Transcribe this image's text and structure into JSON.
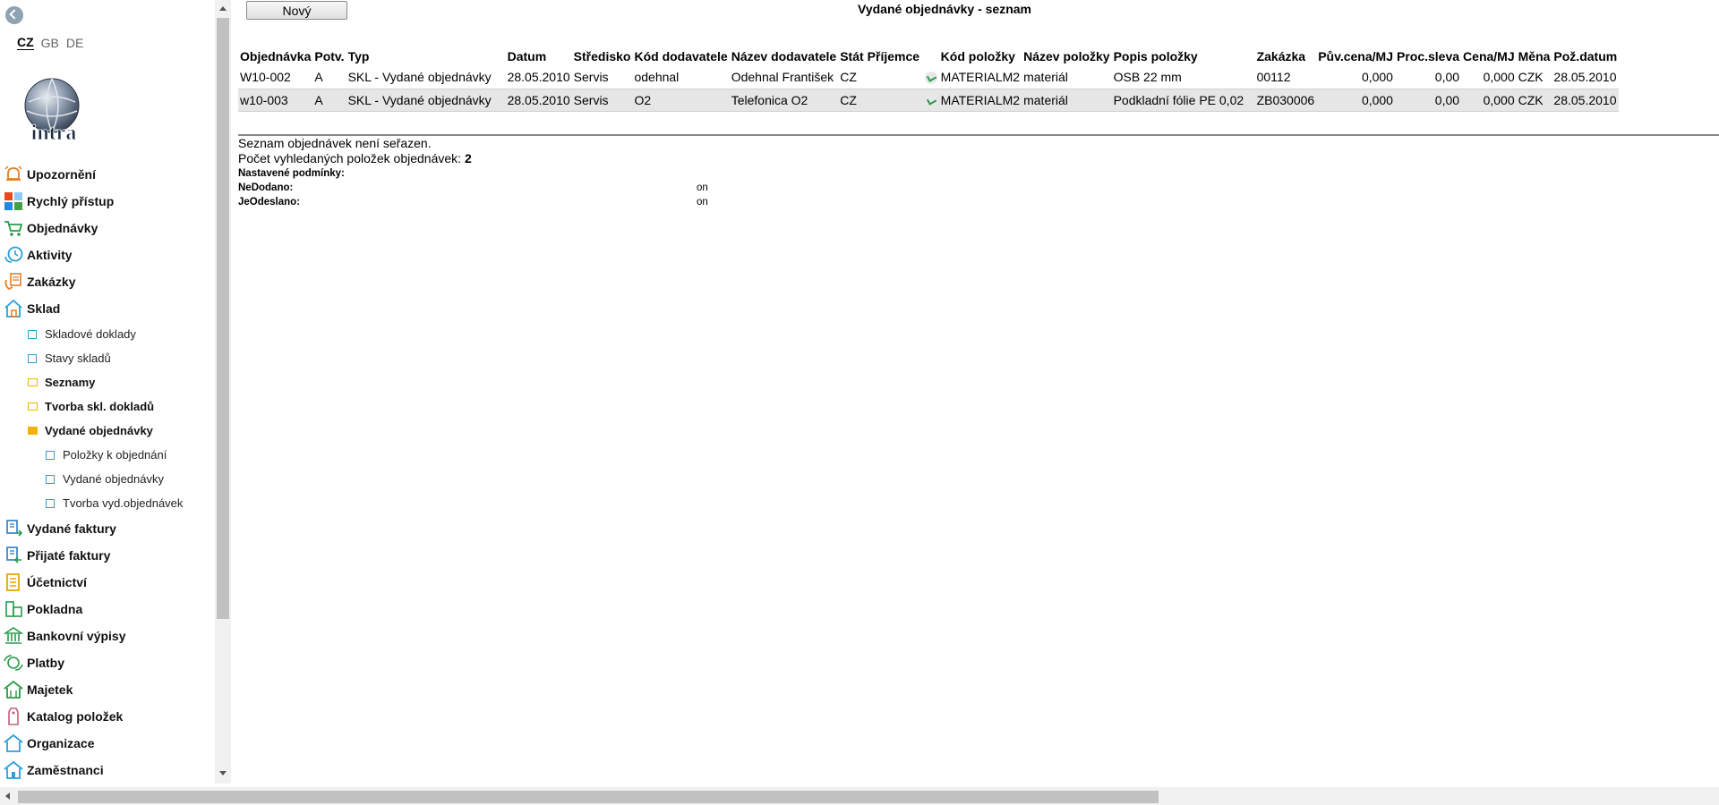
{
  "sidebar": {
    "languages": [
      "CZ",
      "GB",
      "DE"
    ],
    "logo_text": "intra",
    "nav": [
      {
        "label": "Upozornění",
        "icon": "alarm-icon",
        "color": "#e67e22"
      },
      {
        "label": "Rychlý přístup",
        "icon": "quick-access-icon",
        "color": "#2e7bbf"
      },
      {
        "label": "Objednávky",
        "icon": "cart-icon",
        "color": "#2a9a4a"
      },
      {
        "label": "Aktivity",
        "icon": "activity-clock-icon",
        "color": "#2aa0d8"
      },
      {
        "label": "Zakázky",
        "icon": "contracts-icon",
        "color": "#e67e22"
      },
      {
        "label": "Sklad",
        "icon": "warehouse-icon",
        "color": "#2aa0d8"
      }
    ],
    "sklad_sub": [
      {
        "label": "Skladové doklady",
        "type": "page"
      },
      {
        "label": "Stavy skladů",
        "type": "page"
      },
      {
        "label": "Seznamy",
        "type": "folder"
      },
      {
        "label": "Tvorba skl. dokladů",
        "type": "folder"
      },
      {
        "label": "Vydané objednávky",
        "type": "folder-open"
      }
    ],
    "vydane_sub": [
      {
        "label": "Položky k objednání"
      },
      {
        "label": "Vydané objednávky"
      },
      {
        "label": "Tvorba vyd.objednávek"
      }
    ],
    "nav2": [
      {
        "label": "Vydané faktury",
        "icon": "issued-invoice-icon",
        "color": "#2e7bbf"
      },
      {
        "label": "Přijaté faktury",
        "icon": "received-invoice-icon",
        "color": "#2e7bbf"
      },
      {
        "label": "Účetnictví",
        "icon": "accounting-icon",
        "color": "#e6a700"
      },
      {
        "label": "Pokladna",
        "icon": "cashdesk-icon",
        "color": "#2a9a4a"
      },
      {
        "label": "Bankovní výpisy",
        "icon": "bank-icon",
        "color": "#2a9a4a"
      },
      {
        "label": "Platby",
        "icon": "payments-icon",
        "color": "#2a9a4a"
      },
      {
        "label": "Majetek",
        "icon": "property-icon",
        "color": "#2a9a4a"
      },
      {
        "label": "Katalog položek",
        "icon": "catalog-tag-icon",
        "color": "#c0607a"
      },
      {
        "label": "Organizace",
        "icon": "organization-icon",
        "color": "#2aa0d8"
      },
      {
        "label": "Zaměstnanci",
        "icon": "employees-icon",
        "color": "#2aa0d8"
      }
    ]
  },
  "toolbar": {
    "new_label": "Nový"
  },
  "page_title": "Vydané objednávky - seznam",
  "table": {
    "columns": [
      "Objednávka",
      "Potv.",
      "Typ",
      "Datum",
      "Středisko",
      "Kód dodavatele",
      "Název dodavatele",
      "Stát",
      "Příjemce",
      "Kód položky",
      "Název položky",
      "Popis položky",
      "Zakázka",
      "Pův.cena/MJ",
      "Proc.sleva",
      "Cena/MJ",
      "Měna",
      "Pož.datum"
    ],
    "rows": [
      [
        "W10-002",
        "A",
        "SKL - Vydané objednávky",
        "28.05.2010",
        "Servis",
        "odehnal",
        "Odehnal František",
        "CZ",
        "",
        "MATERIALM2",
        "materiál",
        "OSB 22 mm",
        "00112",
        "0,000",
        "0,00",
        "0,000",
        "CZK",
        "28.05.2010"
      ],
      [
        "w10-003",
        "A",
        "SKL - Vydané objednávky",
        "28.05.2010",
        "Servis",
        "O2",
        "Telefonica O2",
        "CZ",
        "",
        "MATERIALM2",
        "materiál",
        "Podkladní fólie PE 0,02",
        "ZB030006",
        "0,000",
        "0,00",
        "0,000",
        "CZK",
        "28.05.2010"
      ]
    ]
  },
  "info": {
    "sort_status": "Seznam objednávek není seřazen.",
    "count_label": "Počet vyhledaných položek objednávek:",
    "count_value": "2"
  },
  "conditions": {
    "heading": "Nastavené podmínky:",
    "items": [
      {
        "name": "NeDodano:",
        "value": "on"
      },
      {
        "name": "JeOdeslano:",
        "value": "on"
      }
    ]
  },
  "colors": {
    "accent": "#2aa0d8",
    "folder": "#f0b400",
    "row_highlight": "#e6e6e6"
  }
}
